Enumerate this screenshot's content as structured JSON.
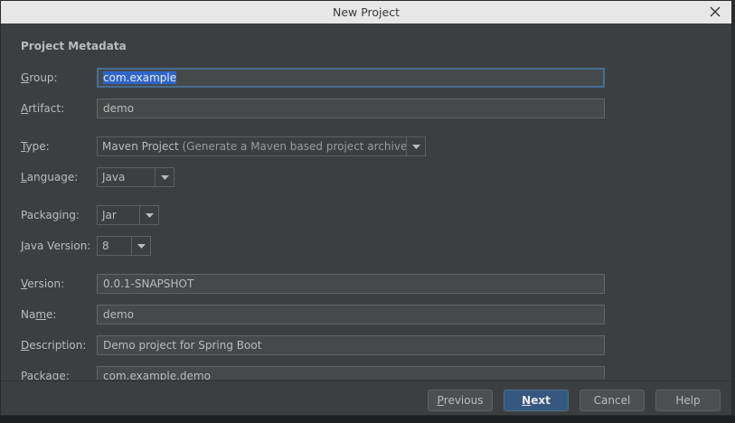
{
  "window": {
    "title": "New Project"
  },
  "section": {
    "title": "Project Metadata"
  },
  "fields": {
    "group": {
      "label_mnemonic": "G",
      "label_rest": "roup:",
      "value": "com.example"
    },
    "artifact": {
      "label_mnemonic": "A",
      "label_rest": "rtifact:",
      "value": "demo"
    },
    "type": {
      "label_mnemonic": "T",
      "label_rest": "ype:",
      "value": "Maven Project",
      "hint": " (Generate a Maven based project archive)"
    },
    "language": {
      "label_mnemonic": "L",
      "label_rest": "anguage:",
      "value": "Java"
    },
    "packaging": {
      "label_mnemonic": "",
      "label_rest": "Packaging:",
      "value": "Jar"
    },
    "java_version": {
      "label_mnemonic": "J",
      "label_rest": "ava Version:",
      "value": "8"
    },
    "version": {
      "label_mnemonic": "V",
      "label_rest": "ersion:",
      "value": "0.0.1-SNAPSHOT"
    },
    "name": {
      "label_pre": "Na",
      "label_mnemonic": "m",
      "label_rest": "e:",
      "value": "demo"
    },
    "description": {
      "label_mnemonic": "D",
      "label_rest": "escription:",
      "value": "Demo project for Spring Boot"
    },
    "package": {
      "label_mnemonic": "",
      "label_rest": "Package:",
      "value": "com.example.demo"
    }
  },
  "buttons": {
    "previous": {
      "mnemonic": "P",
      "rest": "revious"
    },
    "next": {
      "mnemonic": "N",
      "rest": "ext"
    },
    "cancel": "Cancel",
    "help": "Help"
  },
  "colors": {
    "dialog_bg": "#3c3f41",
    "field_bg": "#45494a",
    "focus_border": "#466d94",
    "selection": "#2f65ca",
    "default_button": "#365880"
  },
  "icons": {
    "close": "close-icon",
    "dropdown": "chevron-down-icon"
  }
}
